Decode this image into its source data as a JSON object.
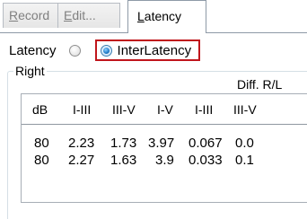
{
  "tabs": [
    {
      "label_acc": "R",
      "label_rest": "ecord",
      "active": false
    },
    {
      "label_acc": "E",
      "label_rest": "dit...",
      "active": false
    },
    {
      "label_acc": "L",
      "label_rest": "atency",
      "active": true
    }
  ],
  "mode": {
    "latency_label": "Latency",
    "interlatency_label": "InterLatency",
    "selected": "InterLatency"
  },
  "group": {
    "legend": "Right",
    "diff_label": "Diff. R/L"
  },
  "table": {
    "columns": [
      "dB",
      "I-III",
      "III-V",
      "I-V",
      "I-III",
      "III-V"
    ],
    "rows": [
      [
        "80",
        "2.23",
        "1.73",
        "3.97",
        "0.067",
        "0.0"
      ],
      [
        "80",
        "2.27",
        "1.63",
        "3.9",
        "0.033",
        "0.1"
      ]
    ]
  },
  "colors": {
    "highlight_border": "#c0161c",
    "radio_selected": "#1f7bc7"
  }
}
